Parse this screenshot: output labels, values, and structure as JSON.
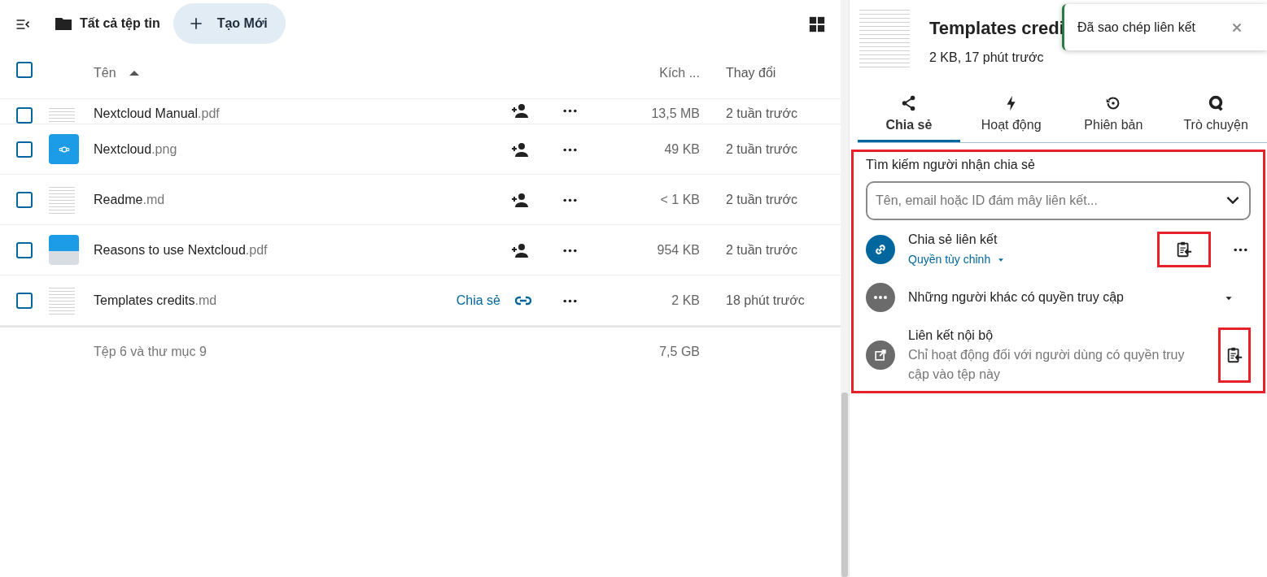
{
  "header": {
    "breadcrumb": "Tất cả tệp tin",
    "new_button": "Tạo Mới"
  },
  "table": {
    "columns": [
      {
        "label": "Tên",
        "sorted": true
      },
      {
        "label": "Kích ..."
      },
      {
        "label": "Thay đổi"
      }
    ],
    "header_checked": false,
    "rows": [
      {
        "name": "Nextcloud Manual",
        "extension": ".pdf",
        "kind": "document",
        "shared": false,
        "size": "13,5 MB",
        "modified": "2 tuần trước",
        "checked": false
      },
      {
        "name": "Nextcloud",
        "extension": ".png",
        "kind": "image",
        "shared": false,
        "size": "49 KB",
        "modified": "2 tuần trước",
        "checked": false
      },
      {
        "name": "Readme",
        "extension": ".md",
        "kind": "document",
        "shared": false,
        "size": "< 1 KB",
        "modified": "2 tuần trước",
        "checked": false
      },
      {
        "name": "Reasons to use Nextcloud",
        "extension": ".pdf",
        "kind": "brochure",
        "shared": false,
        "size": "954 KB",
        "modified": "2 tuần trước",
        "checked": false
      },
      {
        "name": "Templates credits",
        "extension": ".md",
        "kind": "document",
        "shared": true,
        "share_label": "Chia sẻ",
        "size": "2 KB",
        "modified": "18 phút trước",
        "checked": false
      }
    ],
    "footer": {
      "summary": "Tệp 6 và thư mục 9",
      "total_size": "7,5 GB"
    }
  },
  "sidebar": {
    "title": "Templates credi",
    "meta": "2 KB, 17 phút trước",
    "tabs": [
      {
        "label": "Chia sẻ",
        "selected": true
      },
      {
        "label": "Hoạt động",
        "selected": false
      },
      {
        "label": "Phiên bản",
        "selected": false
      },
      {
        "label": "Trò chuyện",
        "selected": false
      }
    ],
    "share": {
      "highlighted": true,
      "search_label": "Tìm kiếm người nhận chia sẻ",
      "search_placeholder": "Tên, email hoặc ID đám mây liên kết...",
      "entries": [
        {
          "kind": "link",
          "title": "Chia sẻ liên kết",
          "subtitle": "Quyền tùy chỉnh",
          "copy_highlighted": true
        },
        {
          "kind": "others",
          "title": "Những người khác có quyền truy cập"
        },
        {
          "kind": "internal",
          "title": "Liên kết nội bộ",
          "subtitle": "Chỉ hoạt động đối với người dùng có quyền truy cập vào tệp này",
          "copy_highlighted": true
        }
      ]
    }
  },
  "toast": {
    "message": "Đã sao chép liên kết"
  }
}
